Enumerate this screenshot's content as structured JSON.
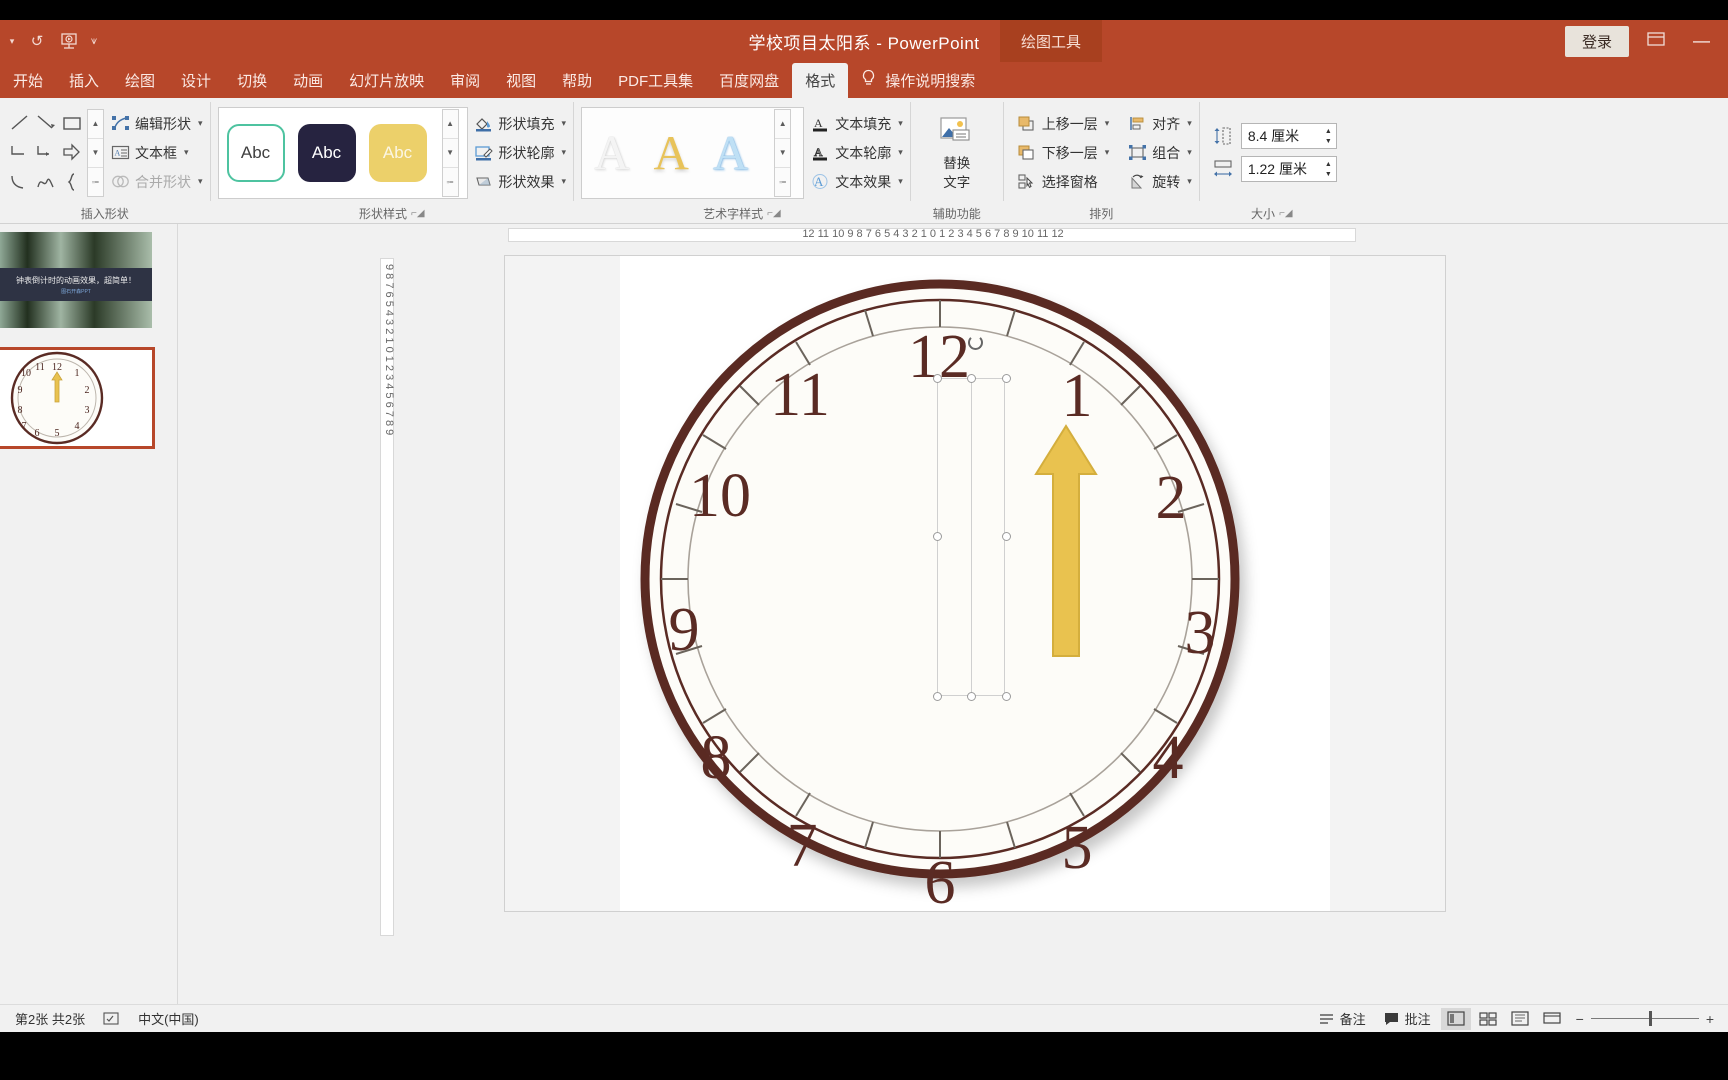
{
  "titlebar": {
    "document_title": "学校项目太阳系  -  PowerPoint",
    "context_tab_label": "绘图工具",
    "signin_label": "登录",
    "quick_access": [
      {
        "name": "autosave-toggle",
        "glyph": "▾"
      },
      {
        "name": "undo-icon",
        "glyph": "↺"
      },
      {
        "name": "start-slideshow-icon",
        "glyph": "▣"
      },
      {
        "name": "customize-qat-icon",
        "glyph": "⩛"
      }
    ],
    "ribbon_display_icon": "▣",
    "minimize_label": "—"
  },
  "tabs": [
    {
      "label": "开始",
      "active": false
    },
    {
      "label": "插入",
      "active": false
    },
    {
      "label": "绘图",
      "active": false
    },
    {
      "label": "设计",
      "active": false
    },
    {
      "label": "切换",
      "active": false
    },
    {
      "label": "动画",
      "active": false
    },
    {
      "label": "幻灯片放映",
      "active": false
    },
    {
      "label": "审阅",
      "active": false
    },
    {
      "label": "视图",
      "active": false
    },
    {
      "label": "帮助",
      "active": false
    },
    {
      "label": "PDF工具集",
      "active": false
    },
    {
      "label": "百度网盘",
      "active": false
    },
    {
      "label": "格式",
      "active": true
    }
  ],
  "tell_me": "操作说明搜索",
  "ribbon": {
    "groups": [
      {
        "name": "insert-shapes",
        "label": "插入形状",
        "commands": [
          {
            "label": "编辑形状",
            "icon": "edit-shape-icon",
            "dropdown": true,
            "disabled": false
          },
          {
            "label": "文本框",
            "icon": "text-box-icon",
            "dropdown": true,
            "disabled": false
          },
          {
            "label": "合并形状",
            "icon": "merge-shapes-icon",
            "dropdown": true,
            "disabled": true
          }
        ]
      },
      {
        "name": "shape-styles",
        "label": "形状样式",
        "gallery": [
          {
            "label": "Abc",
            "style": "outline-teal"
          },
          {
            "label": "Abc",
            "style": "fill-dark"
          },
          {
            "label": "Abc",
            "style": "fill-gold"
          }
        ],
        "commands": [
          {
            "label": "形状填充",
            "icon": "shape-fill-icon",
            "dropdown": true
          },
          {
            "label": "形状轮廓",
            "icon": "shape-outline-icon",
            "dropdown": true
          },
          {
            "label": "形状效果",
            "icon": "shape-effects-icon",
            "dropdown": true
          }
        ]
      },
      {
        "name": "wordart-styles",
        "label": "艺术字样式",
        "gallery": [
          {
            "label": "A",
            "style": "wa-plain"
          },
          {
            "label": "A",
            "style": "wa-gold"
          },
          {
            "label": "A",
            "style": "wa-blue"
          }
        ],
        "commands": [
          {
            "label": "文本填充",
            "icon": "text-fill-icon",
            "dropdown": true
          },
          {
            "label": "文本轮廓",
            "icon": "text-outline-icon",
            "dropdown": true
          },
          {
            "label": "文本效果",
            "icon": "text-effects-icon",
            "dropdown": true
          }
        ]
      },
      {
        "name": "accessibility",
        "label": "辅助功能",
        "big_button": {
          "line1": "替换",
          "line2": "文字",
          "icon": "alt-text-icon"
        }
      },
      {
        "name": "arrange",
        "label": "排列",
        "commands": [
          {
            "label": "上移一层",
            "icon": "bring-forward-icon",
            "dropdown": true
          },
          {
            "label": "下移一层",
            "icon": "send-backward-icon",
            "dropdown": true
          },
          {
            "label": "选择窗格",
            "icon": "selection-pane-icon",
            "dropdown": false
          },
          {
            "label": "对齐",
            "icon": "align-icon",
            "dropdown": true
          },
          {
            "label": "组合",
            "icon": "group-icon",
            "dropdown": true
          },
          {
            "label": "旋转",
            "icon": "rotate-icon",
            "dropdown": true
          }
        ]
      },
      {
        "name": "size",
        "label": "大小",
        "fields": [
          {
            "name": "shape-height",
            "icon": "height-icon",
            "value": "8.4 厘米"
          },
          {
            "name": "shape-width",
            "icon": "width-icon",
            "value": "1.22 厘米"
          }
        ]
      }
    ]
  },
  "thumbnails": [
    {
      "index": 1,
      "selected": false,
      "caption_line1": "钟表倒计时的动画效果，超简单！",
      "caption_line2": "图石开森PPT"
    },
    {
      "index": 2,
      "selected": true,
      "caption_line1": "",
      "caption_line2": ""
    }
  ],
  "ruler": {
    "horizontal": "12  11  10  9  8  7  6  5  4  3  2  1  0  1  2  3  4  5  6  7  8  9  10  11  12",
    "vertical": "9  8  7  6  5  4  3  2  1  0  1  2  3  4  5  6  7  8  9"
  },
  "slide": {
    "clock_numbers": [
      "12",
      "1",
      "2",
      "3",
      "4",
      "5",
      "6",
      "7",
      "8",
      "9",
      "10",
      "11"
    ],
    "hand_color": "#e9c24f",
    "face_color": "#fdfcf8",
    "rim_color": "#5a2b24",
    "highlight_color": "#fdf14a",
    "selected_shape": "clock-hand"
  },
  "status": {
    "slide_counter": "第2张  共2张",
    "spell_icon": "proofing-icon",
    "language": "中文(中国)",
    "notes_label": "备注",
    "comments_label": "批注",
    "views": [
      {
        "name": "normal-view-button",
        "glyph": "▤",
        "active": true
      },
      {
        "name": "slide-sorter-button",
        "glyph": "▦",
        "active": false
      },
      {
        "name": "reading-view-button",
        "glyph": "▥",
        "active": false
      },
      {
        "name": "slideshow-button",
        "glyph": "▭",
        "active": false
      }
    ],
    "zoom_out": "−",
    "zoom_in": "+"
  }
}
